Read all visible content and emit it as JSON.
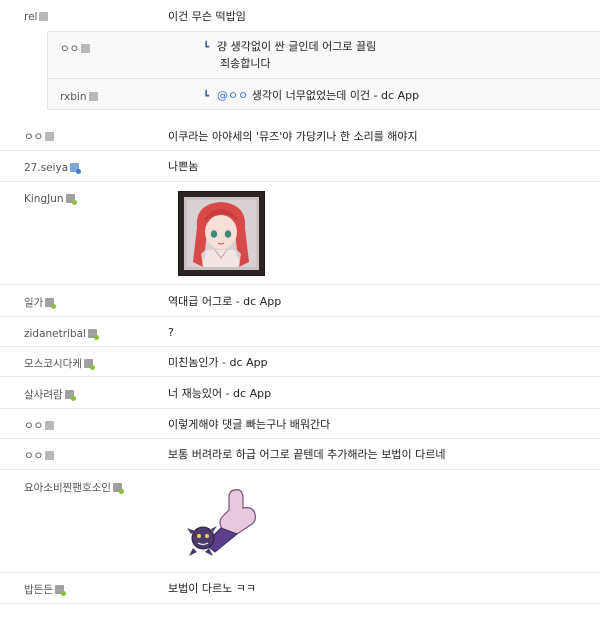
{
  "comments": [
    {
      "nick": "rel",
      "text": "이건 무슨 떡밥임"
    },
    {
      "nick": "rxbin",
      "text": "생각이 너무없었는데 이건 - dc App",
      "mention": "@ㅇㅇ"
    },
    {
      "nick": "ㅇㅇ",
      "text": "이쿠라는 아야세의 '뮤즈'야 가당키나 한 소리를 해야지"
    },
    {
      "nick": "27.seiya",
      "text": "나쁜놈"
    },
    {
      "nick": "KingJun",
      "text": ""
    },
    {
      "nick": "일가",
      "text": "역대급 어그로 - dc App"
    },
    {
      "nick": "zidanetribal",
      "text": "?"
    },
    {
      "nick": "모스코시다케",
      "text": "미친놈인가 - dc App"
    },
    {
      "nick": "살사려람",
      "text": "너 재능있어 - dc App"
    },
    {
      "nick": "ㅇㅇ",
      "text": "이렇게해야 댓글 빠는구나 배워간다"
    },
    {
      "nick": "ㅇㅇ",
      "text": "보통 버려라로 하급 어그로 끝텐데 추가해라는 보법이 다르네"
    },
    {
      "nick": "요아소비찐팬호소인",
      "text": ""
    },
    {
      "nick": "밥든든",
      "text": "보법이 다르노 ㅋㅋ"
    }
  ],
  "reply": {
    "nick": "ㅇㅇ",
    "text_line1": "걍 생각없이 싼 글인데 어그로 끌림",
    "text_line2": "죄송합니다"
  },
  "arrow_glyph": "┗",
  "colors": {
    "link": "#3a6fc9",
    "border": "#ececec",
    "badge_green": "#8bbf3a"
  }
}
